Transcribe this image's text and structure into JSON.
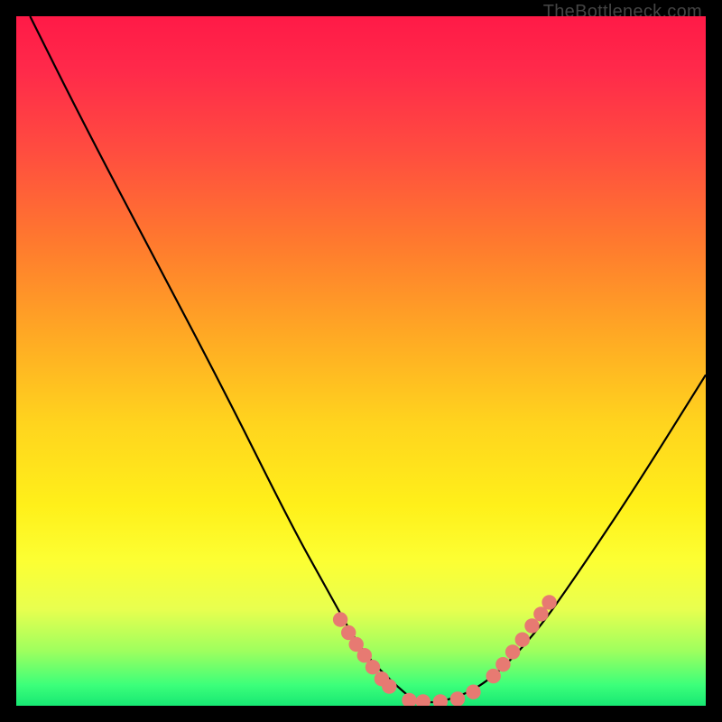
{
  "watermark": "TheBottleneck.com",
  "chart_data": {
    "type": "line",
    "title": "",
    "xlabel": "",
    "ylabel": "",
    "xlim": [
      0,
      100
    ],
    "ylim": [
      0,
      100
    ],
    "series": [
      {
        "name": "curve",
        "x": [
          2,
          10,
          20,
          30,
          40,
          45,
          50,
          55,
          58,
          62,
          68,
          75,
          82,
          90,
          100
        ],
        "y": [
          100,
          84,
          65,
          46,
          26,
          17,
          8,
          3,
          0.5,
          0.5,
          3,
          10,
          20,
          32,
          48
        ],
        "color": "#000000"
      }
    ],
    "markers": [
      {
        "name": "left-cluster",
        "x": [
          47.0,
          48.2,
          49.3,
          50.5,
          51.7,
          53.0,
          54.1
        ],
        "y": [
          12.5,
          10.6,
          8.9,
          7.3,
          5.6,
          3.9,
          2.8
        ],
        "color": "#e77a72"
      },
      {
        "name": "bottom-cluster",
        "x": [
          57.0,
          59.0,
          61.5,
          64.0,
          66.3
        ],
        "y": [
          0.8,
          0.6,
          0.6,
          1.0,
          2.0
        ],
        "color": "#e77a72"
      },
      {
        "name": "right-cluster",
        "x": [
          69.2,
          70.6,
          72.0,
          73.4,
          74.8,
          76.1,
          77.3
        ],
        "y": [
          4.3,
          6.0,
          7.8,
          9.6,
          11.6,
          13.3,
          15.0
        ],
        "color": "#e77a72"
      }
    ]
  }
}
